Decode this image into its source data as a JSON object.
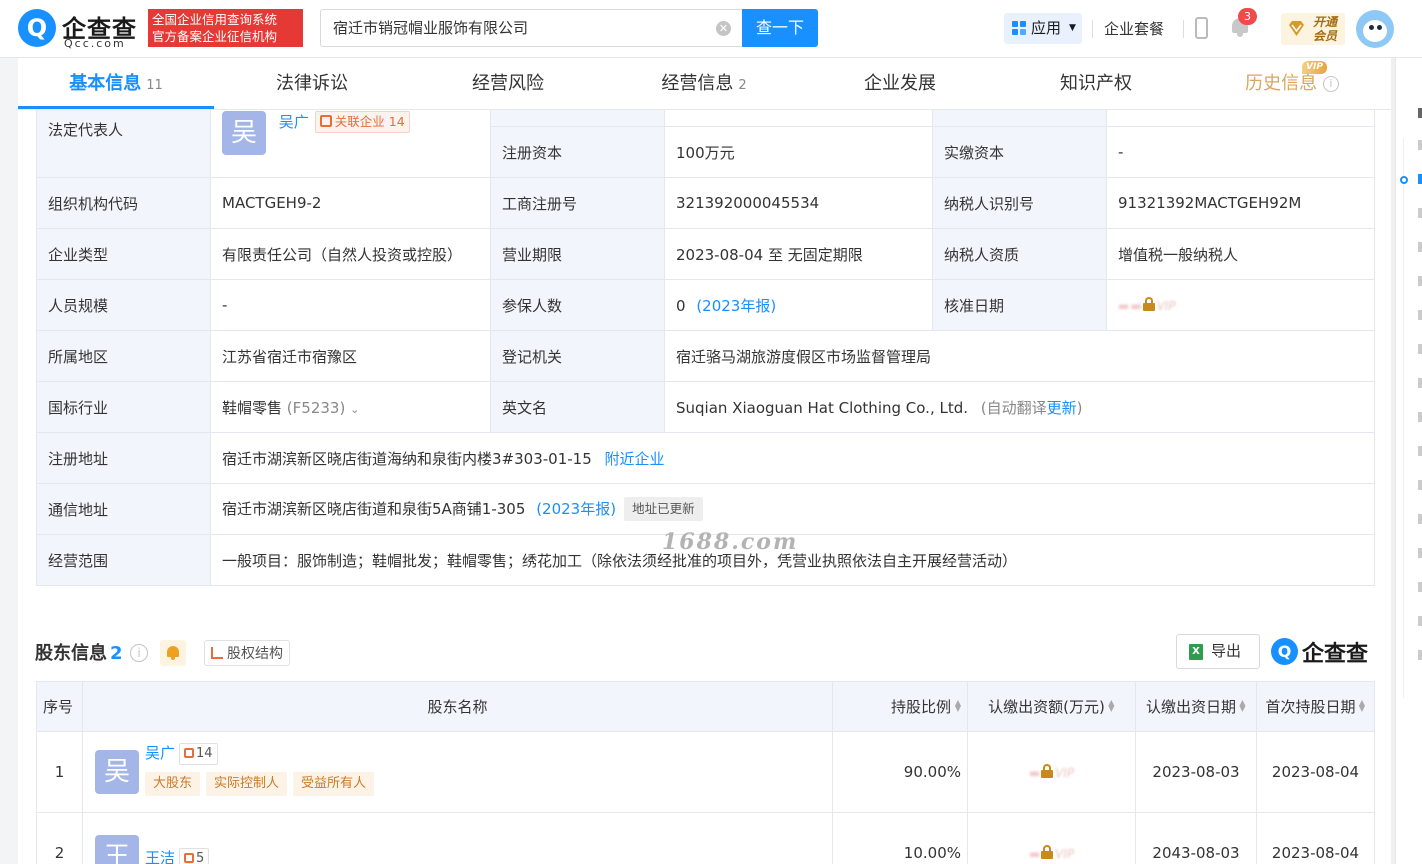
{
  "header": {
    "logo_name": "企查查",
    "logo_sub": "Qcc.com",
    "badge_line1": "全国企业信用查询系统",
    "badge_line2": "官方备案企业征信机构",
    "search_value": "宿迁市销冠帽业服饰有限公司",
    "search_button": "查一下",
    "apps_label": "应用",
    "package_label": "企业套餐",
    "notification_count": "3",
    "vip_line1": "开通",
    "vip_line2": "会员"
  },
  "tabs": [
    {
      "label": "基本信息",
      "count": "11"
    },
    {
      "label": "法律诉讼",
      "count": ""
    },
    {
      "label": "经营风险",
      "count": ""
    },
    {
      "label": "经营信息",
      "count": "2"
    },
    {
      "label": "企业发展",
      "count": ""
    },
    {
      "label": "知识产权",
      "count": ""
    },
    {
      "label": "历史信息",
      "count": ""
    }
  ],
  "history_vip_tag": "VIP",
  "info": {
    "legal_rep_label": "法定代表人",
    "legal_rep_avatar": "吴",
    "legal_rep_name": "吴广",
    "legal_rep_related": "关联企业 14",
    "reg_capital_label": "注册资本",
    "reg_capital_value": "100万元",
    "paid_capital_label": "实缴资本",
    "paid_capital_value": "-",
    "org_code_label": "组织机构代码",
    "org_code_value": "MACTGEH9-2",
    "biz_reg_label": "工商注册号",
    "biz_reg_value": "321392000045534",
    "taxpayer_id_label": "纳税人识别号",
    "taxpayer_id_value": "91321392MACTGEH92M",
    "type_label": "企业类型",
    "type_value": "有限责任公司（自然人投资或控股）",
    "term_label": "营业期限",
    "term_value": "2023-08-04 至 无固定期限",
    "tax_qual_label": "纳税人资质",
    "tax_qual_value": "增值税一般纳税人",
    "staff_label": "人员规模",
    "staff_value": "-",
    "insured_label": "参保人数",
    "insured_value": "0",
    "insured_year": "(2023年报)",
    "approve_label": "核准日期",
    "approve_vip": "VIP",
    "region_label": "所属地区",
    "region_value": "江苏省宿迁市宿豫区",
    "authority_label": "登记机关",
    "authority_value": "宿迁骆马湖旅游度假区市场监督管理局",
    "industry_label": "国标行业",
    "industry_value": "鞋帽零售",
    "industry_code": "(F5233)",
    "english_label": "英文名",
    "english_value": "Suqian Xiaoguan Hat Clothing Co., Ltd.",
    "english_auto": "(自动翻译",
    "english_update": "更新",
    "english_close": ")",
    "reg_addr_label": "注册地址",
    "reg_addr_value": "宿迁市湖滨新区晓店街道海纳和泉街内楼3#303-01-15",
    "nearby_link": "附近企业",
    "mail_addr_label": "通信地址",
    "mail_addr_value": "宿迁市湖滨新区晓店街道和泉街5A商铺1-305",
    "mail_addr_year": "(2023年报)",
    "mail_addr_tag": "地址已更新",
    "scope_label": "经营范围",
    "scope_value": "一般项目：服饰制造；鞋帽批发；鞋帽零售；绣花加工（除依法须经批准的项目外，凭营业执照依法自主开展经营活动）"
  },
  "watermark": "1688.com",
  "shareholders": {
    "title": "股东信息",
    "count": "2",
    "structure_button": "股权结构",
    "export_button": "导出",
    "brand": "企查查",
    "columns": [
      "序号",
      "股东名称",
      "持股比例",
      "认缴出资额(万元)",
      "认缴出资日期",
      "首次持股日期"
    ],
    "rows": [
      {
        "index": "1",
        "avatar": "吴",
        "name": "吴广",
        "related": "14",
        "roles": [
          "大股东",
          "实际控制人",
          "受益所有人"
        ],
        "ratio": "90.00%",
        "amount_vip": "VIP",
        "sub_date": "2023-08-03",
        "first_date": "2023-08-04"
      },
      {
        "index": "2",
        "avatar": "王",
        "name": "王洁",
        "related": "5",
        "roles": [],
        "ratio": "10.00%",
        "amount_vip": "VIP",
        "sub_date": "2043-08-03",
        "first_date": "2023-08-04"
      }
    ]
  },
  "colors": {
    "accent": "#1890ff",
    "label_bg": "#f2f6fc",
    "vip": "#c98a1a",
    "danger": "#e53935"
  }
}
